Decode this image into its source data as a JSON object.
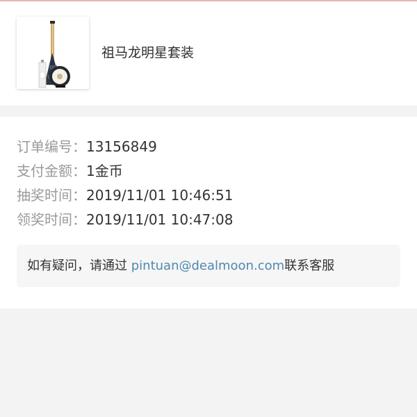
{
  "product": {
    "name": "祖马龙明星套装",
    "image_icon": "perfume-set-icon"
  },
  "order": {
    "number_label": "订单编号：",
    "number_value": "13156849",
    "amount_label": "支付金额：",
    "amount_value": "1金币",
    "draw_time_label": "抽奖时间：",
    "draw_time_value": "2019/11/01 10:46:51",
    "claim_time_label": "领奖时间：",
    "claim_time_value": "2019/11/01 10:47:08"
  },
  "help": {
    "prefix": "如有疑问，请通过 ",
    "email": "pintuan@dealmoon.com",
    "suffix": "联系客服"
  },
  "colors": {
    "label": "#9a9a9a",
    "text": "#333333",
    "link": "#4f88b0",
    "background": "#f3f3f3",
    "accent_line": "#e4b7b3"
  }
}
